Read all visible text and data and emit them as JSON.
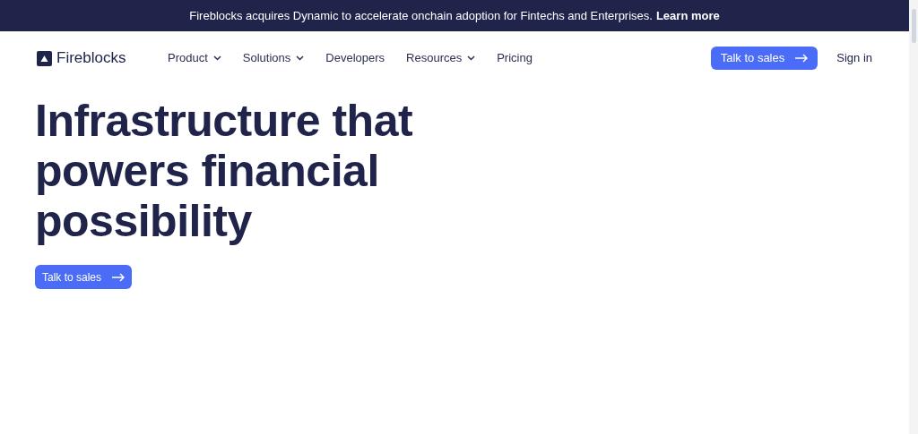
{
  "banner": {
    "text": "Fireblocks acquires Dynamic to accelerate onchain adoption for Fintechs and Enterprises.",
    "link": "Learn more"
  },
  "nav": {
    "logo": "Fireblocks",
    "items": [
      {
        "label": "Product",
        "dropdown": true
      },
      {
        "label": "Solutions",
        "dropdown": true
      },
      {
        "label": "Developers",
        "dropdown": false
      },
      {
        "label": "Resources",
        "dropdown": true
      },
      {
        "label": "Pricing",
        "dropdown": false
      }
    ],
    "cta": "Talk to sales",
    "sign_in": "Sign in"
  },
  "hero": {
    "heading": "Infrastructure that powers financial possibility",
    "cta": "Talk to sales"
  }
}
